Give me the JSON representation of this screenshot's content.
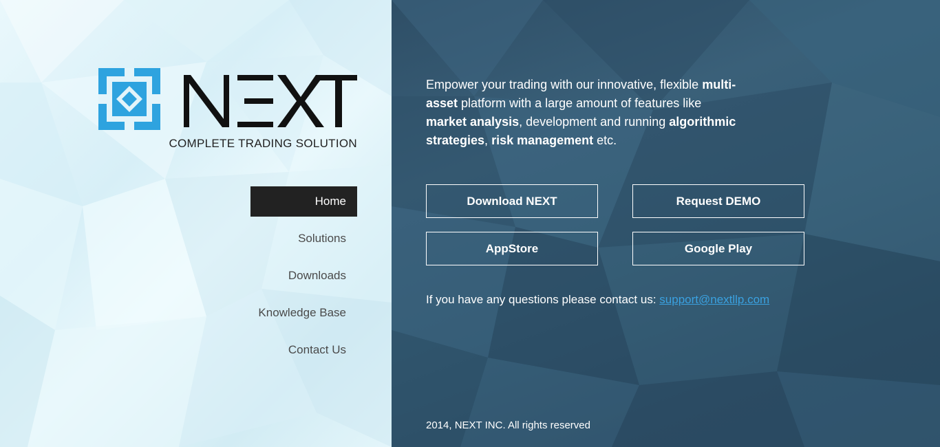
{
  "brand": {
    "name": "NEXT",
    "tagline": "COMPLETE TRADING SOLUTION",
    "logo_mark_color": "#2ea3df",
    "wordmark_color": "#111111",
    "logo_mark_icon": "diamond-knot-icon"
  },
  "nav": {
    "items": [
      {
        "label": "Home",
        "active": true
      },
      {
        "label": "Solutions",
        "active": false
      },
      {
        "label": "Downloads",
        "active": false
      },
      {
        "label": "Knowledge Base",
        "active": false
      },
      {
        "label": "Contact Us",
        "active": false
      }
    ]
  },
  "intro": {
    "segments": [
      {
        "text": "Empower your trading with our innovative, flexible ",
        "bold": false
      },
      {
        "text": "multi-asset",
        "bold": true
      },
      {
        "text": " platform with a large amount of features like ",
        "bold": false
      },
      {
        "text": "market analysis",
        "bold": true
      },
      {
        "text": ", development and running ",
        "bold": false
      },
      {
        "text": "algorithmic strategies",
        "bold": true
      },
      {
        "text": ", ",
        "bold": false
      },
      {
        "text": "risk management",
        "bold": true
      },
      {
        "text": " etc.",
        "bold": false
      }
    ]
  },
  "actions": {
    "download_label": "Download NEXT",
    "demo_label": "Request DEMO",
    "appstore_label": "AppStore",
    "googleplay_label": "Google Play"
  },
  "contact": {
    "text": "If you have any questions please contact us: ",
    "email": "support@nextllp.com"
  },
  "footer": {
    "copyright": "2014, NEXT INC. All rights reserved"
  },
  "colors": {
    "left_bg": "#e3f4fa",
    "right_bg": "#335a72",
    "nav_active_bg": "#222222",
    "link": "#3aa1e0"
  }
}
